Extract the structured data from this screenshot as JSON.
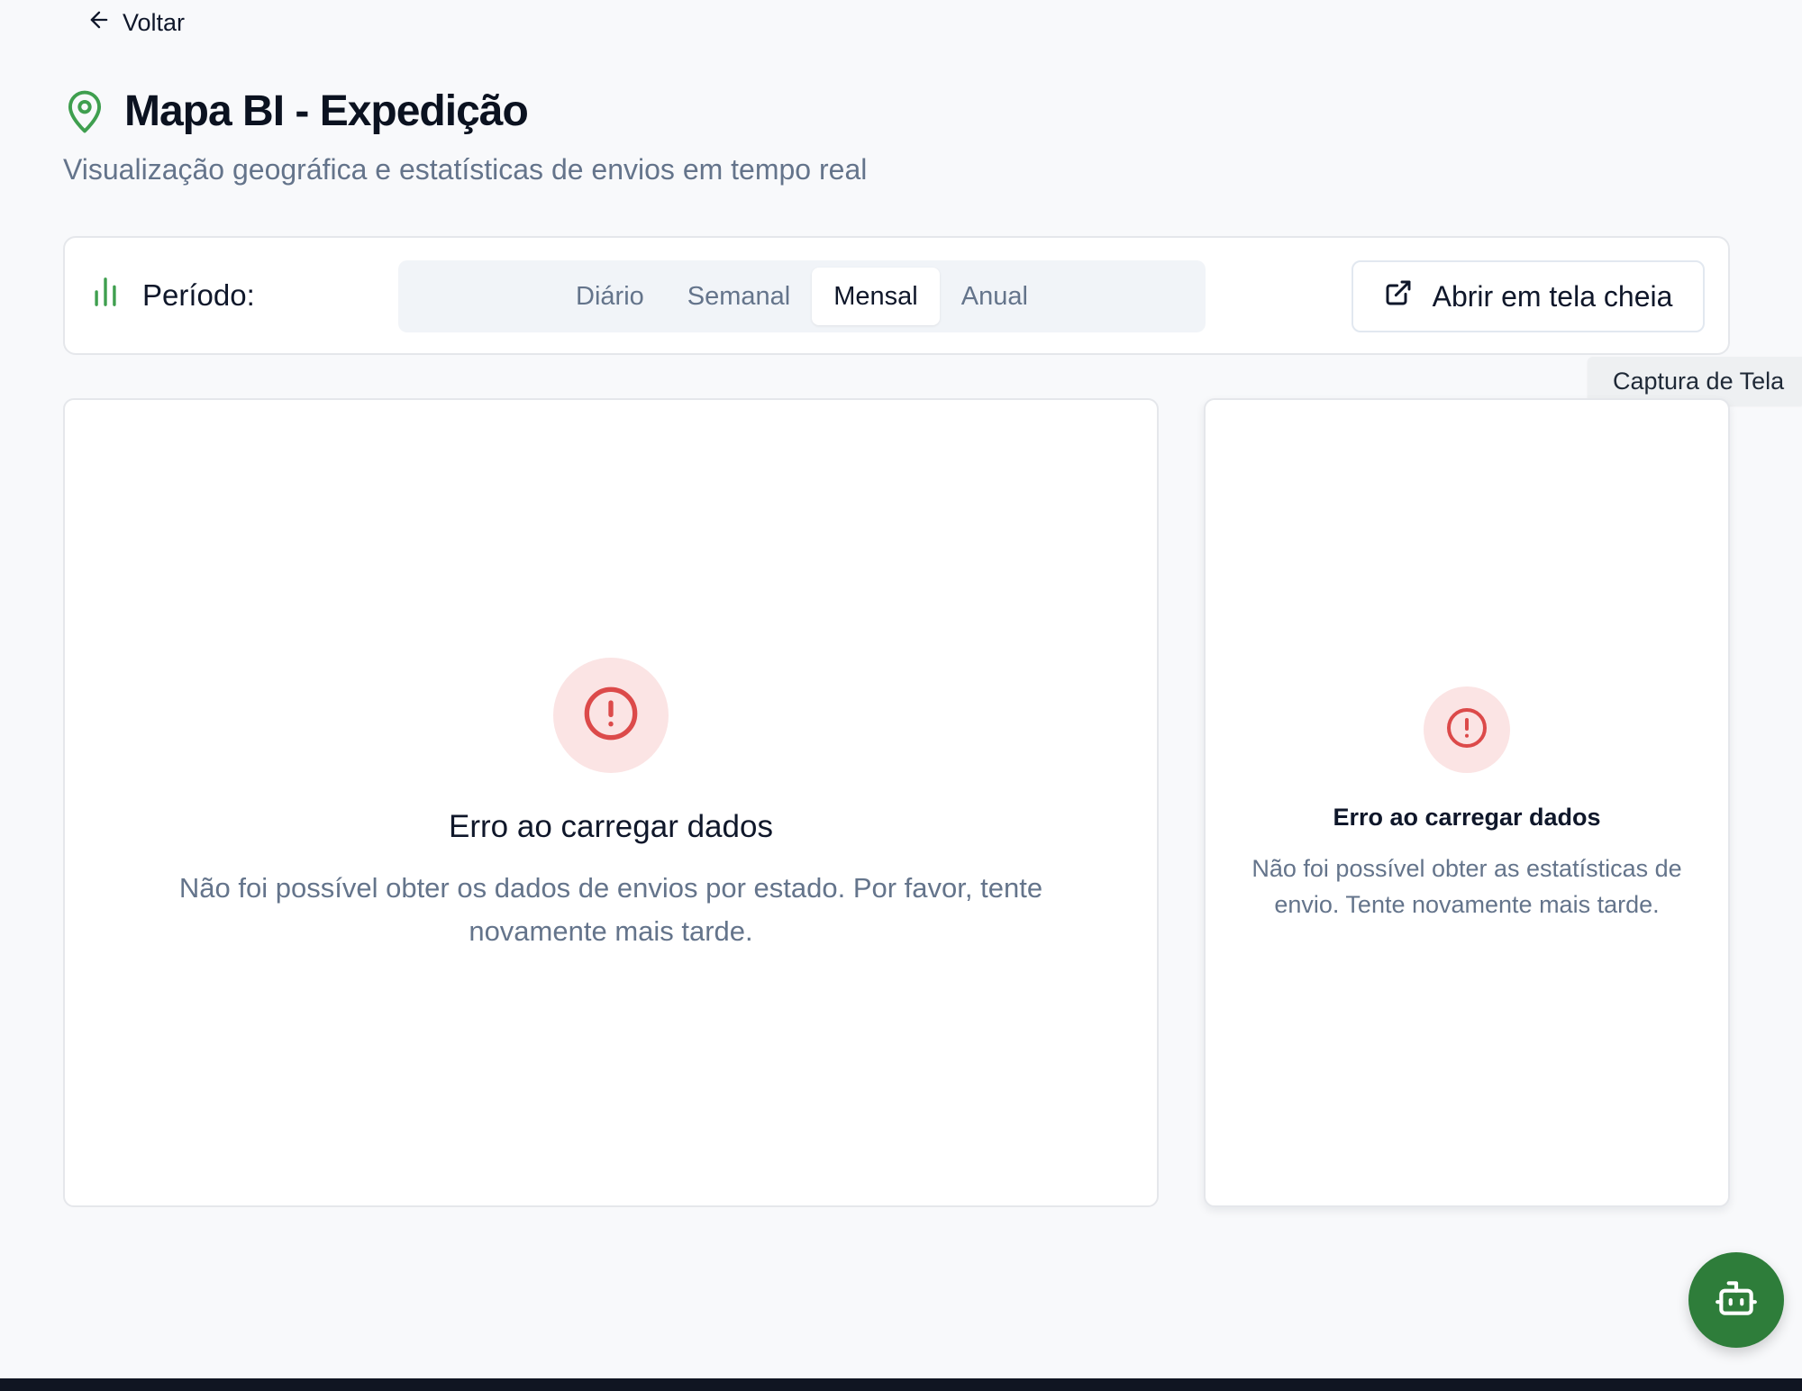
{
  "nav": {
    "back_label": "Voltar"
  },
  "header": {
    "title": "Mapa BI - Expedição",
    "subtitle": "Visualização geográfica e estatísticas de envios em tempo real"
  },
  "toolbar": {
    "period_label": "Período:",
    "periods": [
      {
        "label": "Diário",
        "active": false
      },
      {
        "label": "Semanal",
        "active": false
      },
      {
        "label": "Mensal",
        "active": true
      },
      {
        "label": "Anual",
        "active": false
      }
    ],
    "fullscreen_label": "Abrir em tela cheia"
  },
  "tooltip": {
    "text": "Captura de Tela"
  },
  "map_card": {
    "error_title": "Erro ao carregar dados",
    "error_message": "Não foi possível obter os dados de envios por estado. Por favor, tente novamente mais tarde."
  },
  "stats_card": {
    "error_title": "Erro ao carregar dados",
    "error_message": "Não foi possível obter as estatísticas de envio. Tente novamente mais tarde."
  },
  "colors": {
    "accent_green": "#3f9f4f",
    "bot_green": "#2e7d3a",
    "error_red": "#dc4a4a",
    "error_bg": "#fbe4e4"
  },
  "icons": {
    "back": "arrow-left-icon",
    "title": "map-pin-icon",
    "period": "bar-chart-icon",
    "fullscreen": "external-link-icon",
    "error": "alert-circle-icon",
    "assistant": "bot-icon"
  }
}
